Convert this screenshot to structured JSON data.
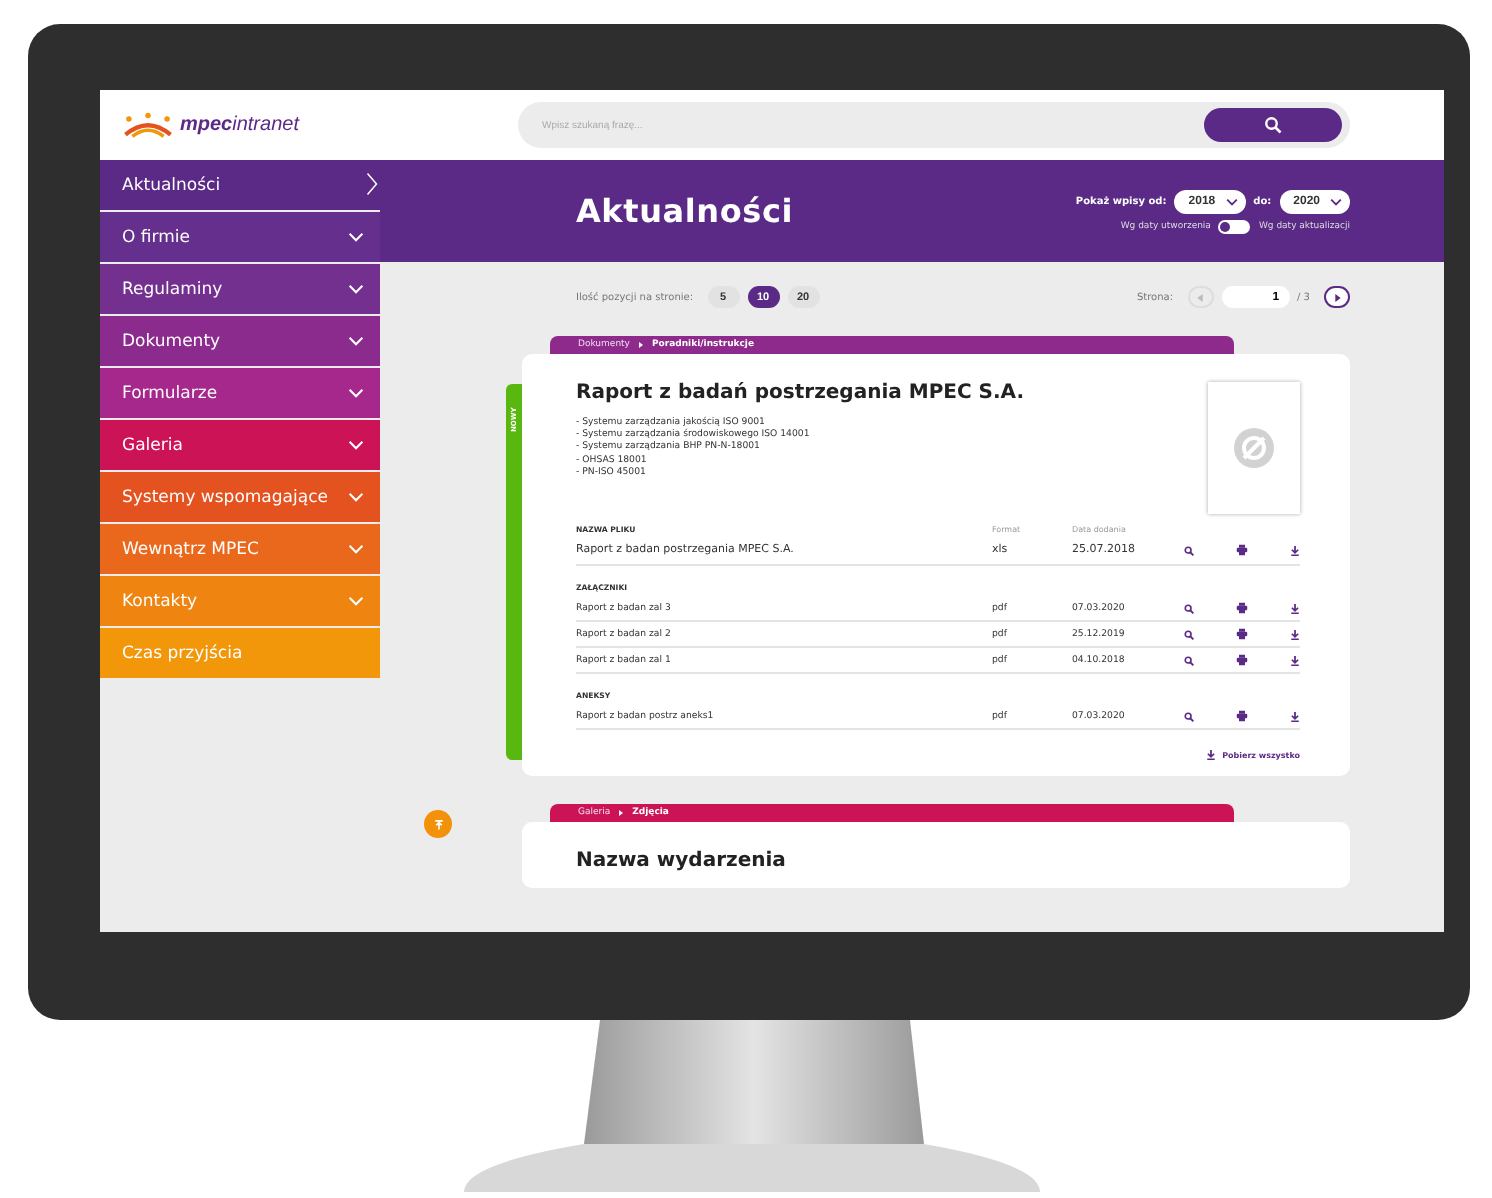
{
  "logo": {
    "bold": "mpec",
    "light": "intranet"
  },
  "search": {
    "placeholder": "Wpisz szukaną frazę..."
  },
  "sidebar": {
    "items": [
      {
        "label": "Aktualności",
        "selected": true,
        "expandable": false,
        "color": "#5b2a86"
      },
      {
        "label": "O firmie",
        "selected": false,
        "expandable": true,
        "color": "#652f8e"
      },
      {
        "label": "Regulaminy",
        "selected": false,
        "expandable": true,
        "color": "#74308f"
      },
      {
        "label": "Dokumenty",
        "selected": false,
        "expandable": true,
        "color": "#8b2b8d"
      },
      {
        "label": "Formularze",
        "selected": false,
        "expandable": true,
        "color": "#a7288c"
      },
      {
        "label": "Galeria",
        "selected": false,
        "expandable": true,
        "color": "#cc1356"
      },
      {
        "label": "Systemy wspomagające",
        "selected": false,
        "expandable": true,
        "color": "#e4521f"
      },
      {
        "label": "Wewnątrz MPEC",
        "selected": false,
        "expandable": true,
        "color": "#ea681c"
      },
      {
        "label": "Kontakty",
        "selected": false,
        "expandable": true,
        "color": "#ef8510"
      },
      {
        "label": "Czas przyjścia",
        "selected": false,
        "expandable": false,
        "color": "#f2960a"
      }
    ]
  },
  "header": {
    "title": "Aktualności",
    "from_label": "Pokaż wpisy od:",
    "from_value": "2018",
    "to_label": "do:",
    "to_value": "2020",
    "toggle_left": "Wg daty utworzenia",
    "toggle_on": false,
    "toggle_right": "Wg daty aktualizacji"
  },
  "pager": {
    "per_page_label": "Ilość pozycji na stronie:",
    "per_page": [
      {
        "label": "5",
        "selected": false
      },
      {
        "label": "10",
        "selected": true
      },
      {
        "label": "20",
        "selected": false
      }
    ],
    "page_label": "Strona:",
    "page_value": "1",
    "page_total": "/ 3"
  },
  "posts": [
    {
      "kind": "document",
      "category": "Dokumenty",
      "subcategory": "Poradniki/instrukcje",
      "color": "#8e2a8c",
      "new": true,
      "badge": "NOWY",
      "title": "Raport z badań postrzegania MPEC S.A.",
      "lines": [
        "- Systemu zarządzania jakością ISO 9001",
        "- Systemu zarządzania środowiskowego ISO 14001",
        "- Systemu zarządzania BHP PN-N-18001",
        "- OHSAS 18001",
        "- PN-ISO 45001"
      ],
      "columns": [
        "NAZWA PLIKU",
        "Format",
        "Data dodania"
      ],
      "files": [
        {
          "name": "Raport z badan postrzegania MPEC S.A.",
          "format": "xls",
          "date": "25.07.2018"
        }
      ],
      "sections": [
        {
          "title": "ZAŁĄCZNIKI",
          "rows": [
            {
              "name": "Raport z badan zal 3",
              "format": "pdf",
              "date": "07.03.2020"
            },
            {
              "name": "Raport z badan zal 2",
              "format": "pdf",
              "date": "25.12.2019"
            },
            {
              "name": "Raport z badan zal 1",
              "format": "pdf",
              "date": "04.10.2018"
            }
          ]
        },
        {
          "title": "ANEKSY",
          "rows": [
            {
              "name": "Raport z badan postrz aneks1",
              "format": "pdf",
              "date": "07.03.2020"
            }
          ]
        }
      ],
      "download_all": "Pobierz wszystko"
    },
    {
      "kind": "gallery",
      "category": "Galeria",
      "subcategory": "Zdjęcia",
      "color": "#cc1356",
      "new": false,
      "title": "Nazwa wydarzenia"
    }
  ]
}
